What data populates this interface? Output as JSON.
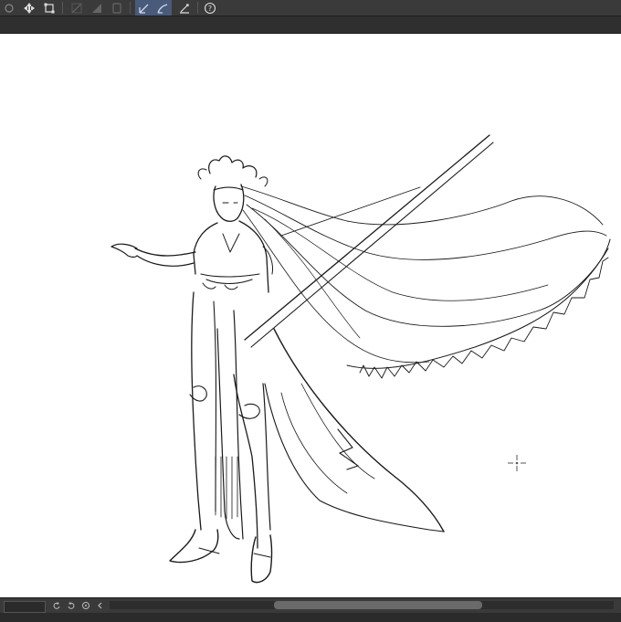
{
  "app": {
    "colors": {
      "toolbar_bg": "#3a3a3a",
      "active_tool": "#4a5a7a",
      "canvas_bg": "#ffffff",
      "stroke": "#1a1a1a"
    }
  },
  "toolbar": {
    "tools": [
      {
        "name": "selection-tool-icon",
        "icon": "selection"
      },
      {
        "name": "move-tool-icon",
        "icon": "move"
      },
      {
        "name": "transform-tool-icon",
        "icon": "transform"
      },
      {
        "name": "fill-tool-icon",
        "icon": "fill"
      },
      {
        "name": "gradient-tool-icon",
        "icon": "gradient"
      },
      {
        "name": "layer-tool-icon",
        "icon": "layer"
      },
      {
        "name": "pen-tool-icon",
        "icon": "pen",
        "active": true
      },
      {
        "name": "lasso-pen-icon",
        "icon": "lasso",
        "active": true
      },
      {
        "name": "ruler-tool-icon",
        "icon": "ruler"
      },
      {
        "name": "help-icon",
        "icon": "help"
      }
    ]
  },
  "statusbar": {
    "zoom_value": "",
    "buttons": [
      "rotate-left-icon",
      "rotate-right-icon",
      "reset-view-icon",
      "collapse-icon"
    ]
  }
}
